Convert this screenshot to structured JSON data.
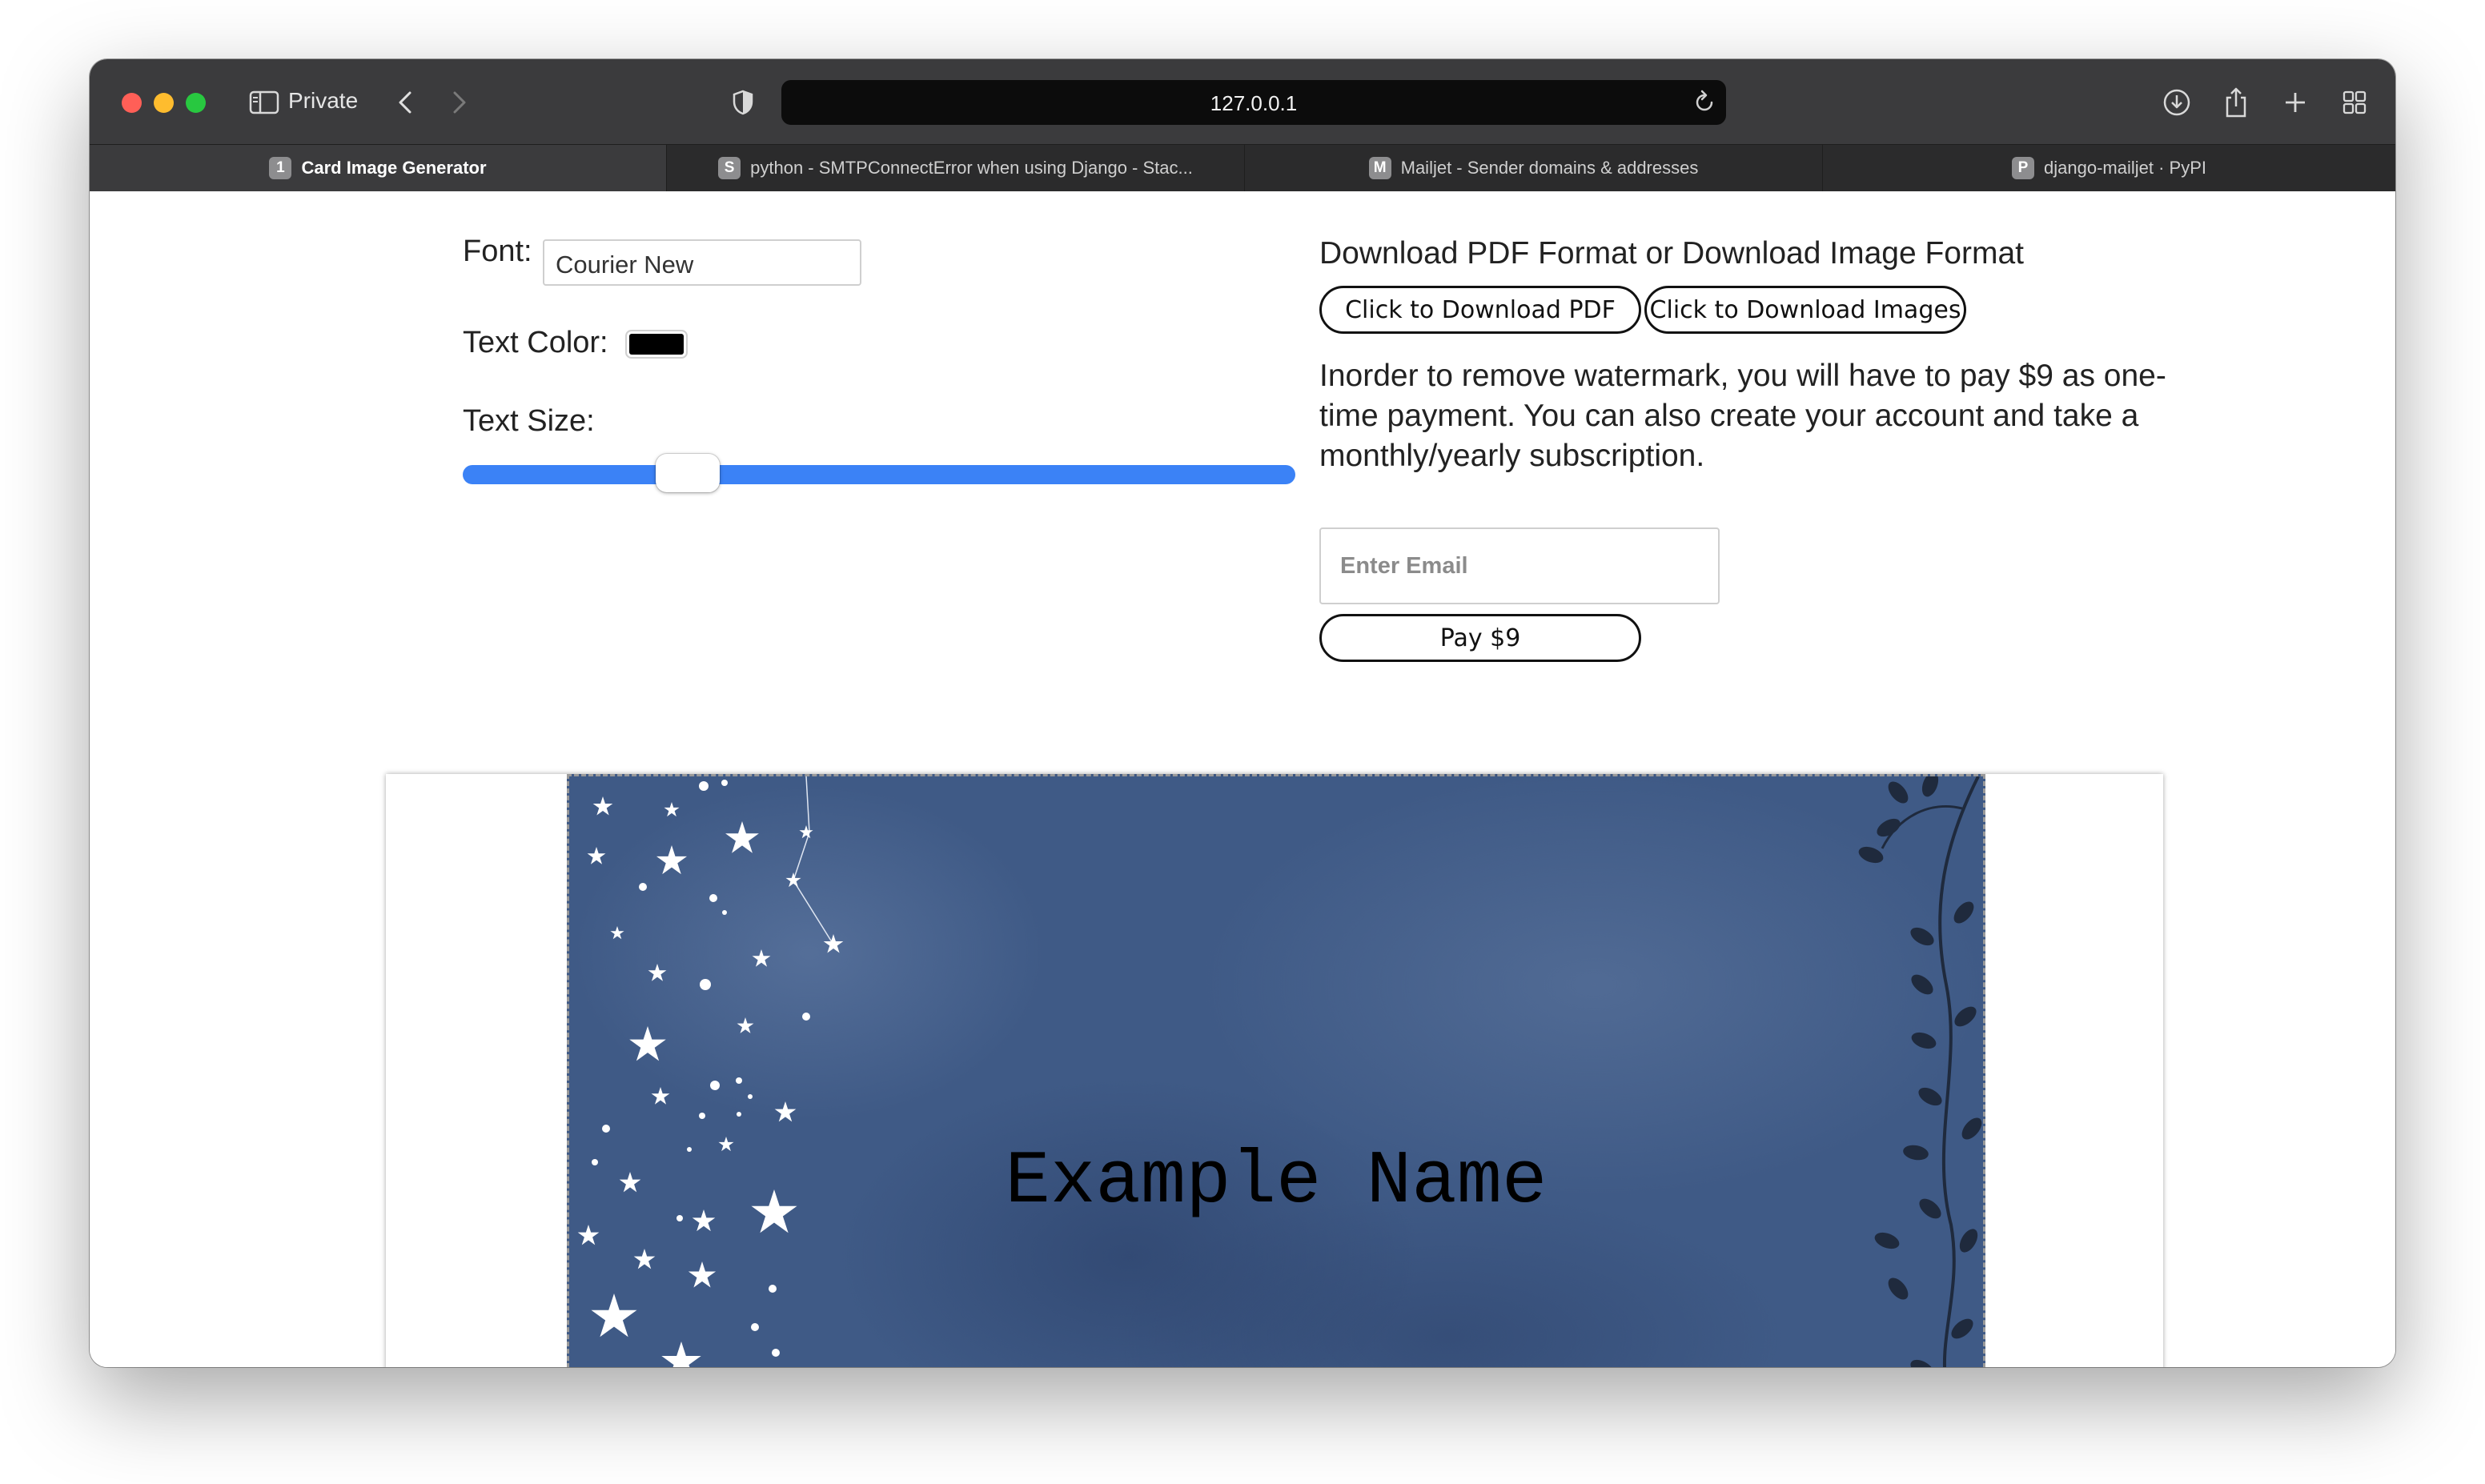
{
  "browser": {
    "private_label": "Private",
    "url": "127.0.0.1",
    "tabs": [
      {
        "fav": "1",
        "label": "Card Image Generator",
        "active": true
      },
      {
        "fav": "S",
        "label": "python - SMTPConnectError when using Django - Stac..."
      },
      {
        "fav": "M",
        "label": "Mailjet - Sender domains & addresses"
      },
      {
        "fav": "P",
        "label": "django-mailjet · PyPI"
      }
    ]
  },
  "settings": {
    "font_label": "Font:",
    "font_value": "Courier New",
    "text_color_label": "Text Color:",
    "text_color": "#000000",
    "text_size_label": "Text Size:",
    "text_size_fraction": 0.27
  },
  "download": {
    "title": "Download PDF Format or Download Image Format",
    "pdf_button": "Click to Download PDF",
    "images_button": "Click to Download Images"
  },
  "payment": {
    "notice": "Inorder to remove watermark, you will have to pay $9 as one-time payment. You can also create your account and take a monthly/yearly subscription.",
    "email_placeholder": "Enter Email",
    "pay_button": "Pay $9"
  },
  "card": {
    "name": "Example Name",
    "background_color": "#3f5a86",
    "accent_icons": [
      "star-icon",
      "leaf-branch-icon"
    ]
  },
  "colors": {
    "slider_fill": "#3b82f6",
    "browser_toolbar": "#3b3b3d"
  }
}
